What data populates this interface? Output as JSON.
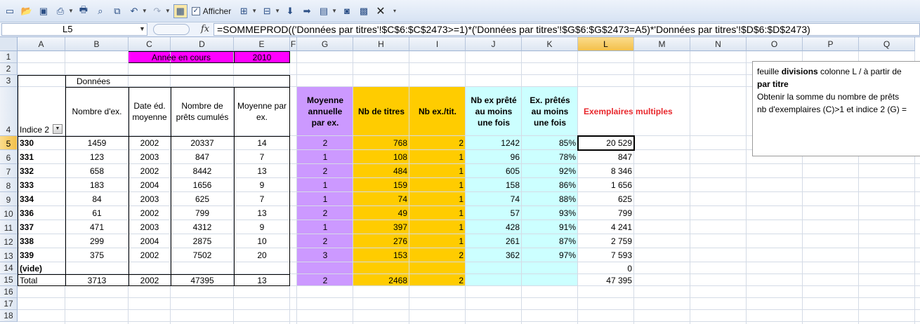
{
  "toolbar": {
    "afficher_label": "Afficher",
    "icons": [
      "new-icon",
      "open-icon",
      "save-icon",
      "print-preview-icon",
      "print-icon",
      "search-icon",
      "copy-icon",
      "undo-icon",
      "redo-icon",
      "grid-icon",
      "checkbox-icon",
      "tool-a-icon",
      "tool-b-icon",
      "tool-c-icon",
      "tool-d-icon",
      "tool-e-icon",
      "camera-icon",
      "tool-f-icon",
      "close-icon",
      "more-icon"
    ]
  },
  "formula_bar": {
    "name_box": "L5",
    "fx": "fx",
    "formula": "=SOMMEPROD(('Données par titres'!$C$6:$C$2473>=1)*('Données par titres'!$G$6:$G$2473=A5)*'Données par titres'!$D$6:$D$2473)"
  },
  "columns": [
    "A",
    "B",
    "C",
    "D",
    "E",
    "F",
    "G",
    "H",
    "I",
    "J",
    "K",
    "L",
    "M",
    "N",
    "O",
    "P",
    "Q"
  ],
  "rows": [
    "1",
    "2",
    "3",
    "4",
    "5",
    "6",
    "7",
    "8",
    "9",
    "10",
    "11",
    "12",
    "13",
    "14",
    "15",
    "16",
    "17",
    "18"
  ],
  "header": {
    "annee_label": "Année en cours",
    "annee_value": "2010",
    "donnees": "Données",
    "indice": "Indice 2",
    "nb_ex": "Nombre d'ex.",
    "date_ed_1": "Date éd.",
    "date_ed_2": "moyenne",
    "nb_prets_1": "Nombre de",
    "nb_prets_2": "prêts cumulés",
    "moy_1": "Moyenne par",
    "moy_2": "ex.",
    "g_1": "Moyenne",
    "g_2": "annuelle",
    "g_3": "par ex.",
    "h": "Nb de titres",
    "i": "Nb ex./tit.",
    "j_1": "Nb ex prêté",
    "j_2": "au moins",
    "j_3": "une fois",
    "k_1": "Ex. prêtés",
    "k_2": "au moins",
    "k_3": "une fois",
    "l": "Exemplaires multiples"
  },
  "data_rows": [
    {
      "a": "330",
      "b": "1459",
      "c": "2002",
      "d": "20337",
      "e": "14",
      "g": "2",
      "h": "768",
      "i": "2",
      "j": "1242",
      "k": "85%",
      "l": "20 529"
    },
    {
      "a": "331",
      "b": "123",
      "c": "2003",
      "d": "847",
      "e": "7",
      "g": "1",
      "h": "108",
      "i": "1",
      "j": "96",
      "k": "78%",
      "l": "847"
    },
    {
      "a": "332",
      "b": "658",
      "c": "2002",
      "d": "8442",
      "e": "13",
      "g": "2",
      "h": "484",
      "i": "1",
      "j": "605",
      "k": "92%",
      "l": "8 346"
    },
    {
      "a": "333",
      "b": "183",
      "c": "2004",
      "d": "1656",
      "e": "9",
      "g": "1",
      "h": "159",
      "i": "1",
      "j": "158",
      "k": "86%",
      "l": "1 656"
    },
    {
      "a": "334",
      "b": "84",
      "c": "2003",
      "d": "625",
      "e": "7",
      "g": "1",
      "h": "74",
      "i": "1",
      "j": "74",
      "k": "88%",
      "l": "625"
    },
    {
      "a": "336",
      "b": "61",
      "c": "2002",
      "d": "799",
      "e": "13",
      "g": "2",
      "h": "49",
      "i": "1",
      "j": "57",
      "k": "93%",
      "l": "799"
    },
    {
      "a": "337",
      "b": "471",
      "c": "2003",
      "d": "4312",
      "e": "9",
      "g": "1",
      "h": "397",
      "i": "1",
      "j": "428",
      "k": "91%",
      "l": "4 241"
    },
    {
      "a": "338",
      "b": "299",
      "c": "2004",
      "d": "2875",
      "e": "10",
      "g": "2",
      "h": "276",
      "i": "1",
      "j": "261",
      "k": "87%",
      "l": "2 759"
    },
    {
      "a": "339",
      "b": "375",
      "c": "2002",
      "d": "7502",
      "e": "20",
      "g": "3",
      "h": "153",
      "i": "2",
      "j": "362",
      "k": "97%",
      "l": "7 593"
    },
    {
      "a": "(vide)",
      "b": "",
      "c": "",
      "d": "",
      "e": "",
      "g": "",
      "h": "",
      "i": "",
      "j": "",
      "k": "",
      "l": "0"
    },
    {
      "a": "Total",
      "b": "3713",
      "c": "2002",
      "d": "47395",
      "e": "13",
      "g": "2",
      "h": "2468",
      "i": "2",
      "j": "",
      "k": "",
      "l": "47 395"
    }
  ],
  "comment": {
    "line1_pre": "feuille ",
    "line1_bold": "divisions",
    "line1_post": " colonne L / à partir de",
    "line2": "par titre",
    "line3": "Obtenir la somme du nombre de prêts",
    "line4": "nb d'exemplaires (C)>1 et indice 2 (G) ="
  },
  "colors": {
    "magenta": "#ff00ff",
    "purple": "#cc99ff",
    "orange": "#ffcc00",
    "cyan": "#ccffff",
    "red_title": "#e8262b",
    "selection": "#f3c04a"
  }
}
